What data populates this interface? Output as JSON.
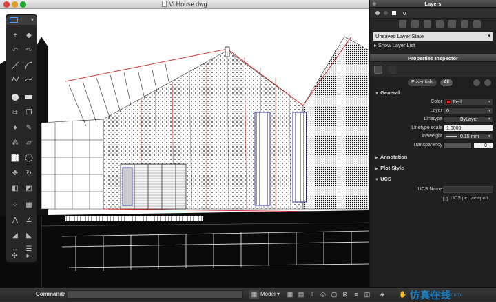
{
  "window": {
    "title": "Vi House.dwg"
  },
  "layers_panel": {
    "title": "Layers",
    "current_layer": "0",
    "layer_state": "Unsaved Layer State",
    "show_layer_list": "Show Layer List"
  },
  "properties_inspector": {
    "title": "Properties Inspector",
    "tabs": {
      "essentials": "Essentials",
      "all": "All"
    },
    "sections": {
      "general": "General",
      "annotation": "Annotation",
      "plot_style": "Plot Style",
      "ucs": "UCS"
    },
    "general": {
      "color_label": "Color",
      "color_value": "Red",
      "layer_label": "Layer",
      "layer_value": "0",
      "linetype_label": "Linetype",
      "linetype_value": "ByLayer",
      "ltscale_label": "Linetype scale",
      "ltscale_value": "1.0000",
      "lineweight_label": "Lineweight",
      "lineweight_value": "0.15 mm",
      "transparency_label": "Transparency",
      "transparency_value": "0"
    },
    "ucs": {
      "name_label": "UCS Name",
      "per_viewport_label": "UCS per viewport"
    }
  },
  "command_bar": {
    "label": "Command:",
    "layout": "Model"
  },
  "watermark": {
    "text": "仿真在线",
    "url": "www.1CAE.com"
  },
  "colors": {
    "accent": "#4ea1ff",
    "selection_red": "#e02020"
  }
}
